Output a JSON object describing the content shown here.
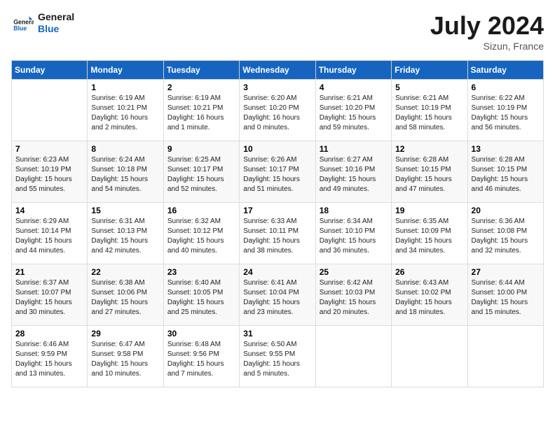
{
  "header": {
    "logo_general": "General",
    "logo_blue": "Blue",
    "month_year": "July 2024",
    "location": "Sizun, France"
  },
  "days_of_week": [
    "Sunday",
    "Monday",
    "Tuesday",
    "Wednesday",
    "Thursday",
    "Friday",
    "Saturday"
  ],
  "weeks": [
    [
      {
        "day": "",
        "info": ""
      },
      {
        "day": "1",
        "info": "Sunrise: 6:19 AM\nSunset: 10:21 PM\nDaylight: 16 hours\nand 2 minutes."
      },
      {
        "day": "2",
        "info": "Sunrise: 6:19 AM\nSunset: 10:21 PM\nDaylight: 16 hours\nand 1 minute."
      },
      {
        "day": "3",
        "info": "Sunrise: 6:20 AM\nSunset: 10:20 PM\nDaylight: 16 hours\nand 0 minutes."
      },
      {
        "day": "4",
        "info": "Sunrise: 6:21 AM\nSunset: 10:20 PM\nDaylight: 15 hours\nand 59 minutes."
      },
      {
        "day": "5",
        "info": "Sunrise: 6:21 AM\nSunset: 10:19 PM\nDaylight: 15 hours\nand 58 minutes."
      },
      {
        "day": "6",
        "info": "Sunrise: 6:22 AM\nSunset: 10:19 PM\nDaylight: 15 hours\nand 56 minutes."
      }
    ],
    [
      {
        "day": "7",
        "info": "Sunrise: 6:23 AM\nSunset: 10:19 PM\nDaylight: 15 hours\nand 55 minutes."
      },
      {
        "day": "8",
        "info": "Sunrise: 6:24 AM\nSunset: 10:18 PM\nDaylight: 15 hours\nand 54 minutes."
      },
      {
        "day": "9",
        "info": "Sunrise: 6:25 AM\nSunset: 10:17 PM\nDaylight: 15 hours\nand 52 minutes."
      },
      {
        "day": "10",
        "info": "Sunrise: 6:26 AM\nSunset: 10:17 PM\nDaylight: 15 hours\nand 51 minutes."
      },
      {
        "day": "11",
        "info": "Sunrise: 6:27 AM\nSunset: 10:16 PM\nDaylight: 15 hours\nand 49 minutes."
      },
      {
        "day": "12",
        "info": "Sunrise: 6:28 AM\nSunset: 10:15 PM\nDaylight: 15 hours\nand 47 minutes."
      },
      {
        "day": "13",
        "info": "Sunrise: 6:28 AM\nSunset: 10:15 PM\nDaylight: 15 hours\nand 46 minutes."
      }
    ],
    [
      {
        "day": "14",
        "info": "Sunrise: 6:29 AM\nSunset: 10:14 PM\nDaylight: 15 hours\nand 44 minutes."
      },
      {
        "day": "15",
        "info": "Sunrise: 6:31 AM\nSunset: 10:13 PM\nDaylight: 15 hours\nand 42 minutes."
      },
      {
        "day": "16",
        "info": "Sunrise: 6:32 AM\nSunset: 10:12 PM\nDaylight: 15 hours\nand 40 minutes."
      },
      {
        "day": "17",
        "info": "Sunrise: 6:33 AM\nSunset: 10:11 PM\nDaylight: 15 hours\nand 38 minutes."
      },
      {
        "day": "18",
        "info": "Sunrise: 6:34 AM\nSunset: 10:10 PM\nDaylight: 15 hours\nand 36 minutes."
      },
      {
        "day": "19",
        "info": "Sunrise: 6:35 AM\nSunset: 10:09 PM\nDaylight: 15 hours\nand 34 minutes."
      },
      {
        "day": "20",
        "info": "Sunrise: 6:36 AM\nSunset: 10:08 PM\nDaylight: 15 hours\nand 32 minutes."
      }
    ],
    [
      {
        "day": "21",
        "info": "Sunrise: 6:37 AM\nSunset: 10:07 PM\nDaylight: 15 hours\nand 30 minutes."
      },
      {
        "day": "22",
        "info": "Sunrise: 6:38 AM\nSunset: 10:06 PM\nDaylight: 15 hours\nand 27 minutes."
      },
      {
        "day": "23",
        "info": "Sunrise: 6:40 AM\nSunset: 10:05 PM\nDaylight: 15 hours\nand 25 minutes."
      },
      {
        "day": "24",
        "info": "Sunrise: 6:41 AM\nSunset: 10:04 PM\nDaylight: 15 hours\nand 23 minutes."
      },
      {
        "day": "25",
        "info": "Sunrise: 6:42 AM\nSunset: 10:03 PM\nDaylight: 15 hours\nand 20 minutes."
      },
      {
        "day": "26",
        "info": "Sunrise: 6:43 AM\nSunset: 10:02 PM\nDaylight: 15 hours\nand 18 minutes."
      },
      {
        "day": "27",
        "info": "Sunrise: 6:44 AM\nSunset: 10:00 PM\nDaylight: 15 hours\nand 15 minutes."
      }
    ],
    [
      {
        "day": "28",
        "info": "Sunrise: 6:46 AM\nSunset: 9:59 PM\nDaylight: 15 hours\nand 13 minutes."
      },
      {
        "day": "29",
        "info": "Sunrise: 6:47 AM\nSunset: 9:58 PM\nDaylight: 15 hours\nand 10 minutes."
      },
      {
        "day": "30",
        "info": "Sunrise: 6:48 AM\nSunset: 9:56 PM\nDaylight: 15 hours\nand 7 minutes."
      },
      {
        "day": "31",
        "info": "Sunrise: 6:50 AM\nSunset: 9:55 PM\nDaylight: 15 hours\nand 5 minutes."
      },
      {
        "day": "",
        "info": ""
      },
      {
        "day": "",
        "info": ""
      },
      {
        "day": "",
        "info": ""
      }
    ]
  ]
}
